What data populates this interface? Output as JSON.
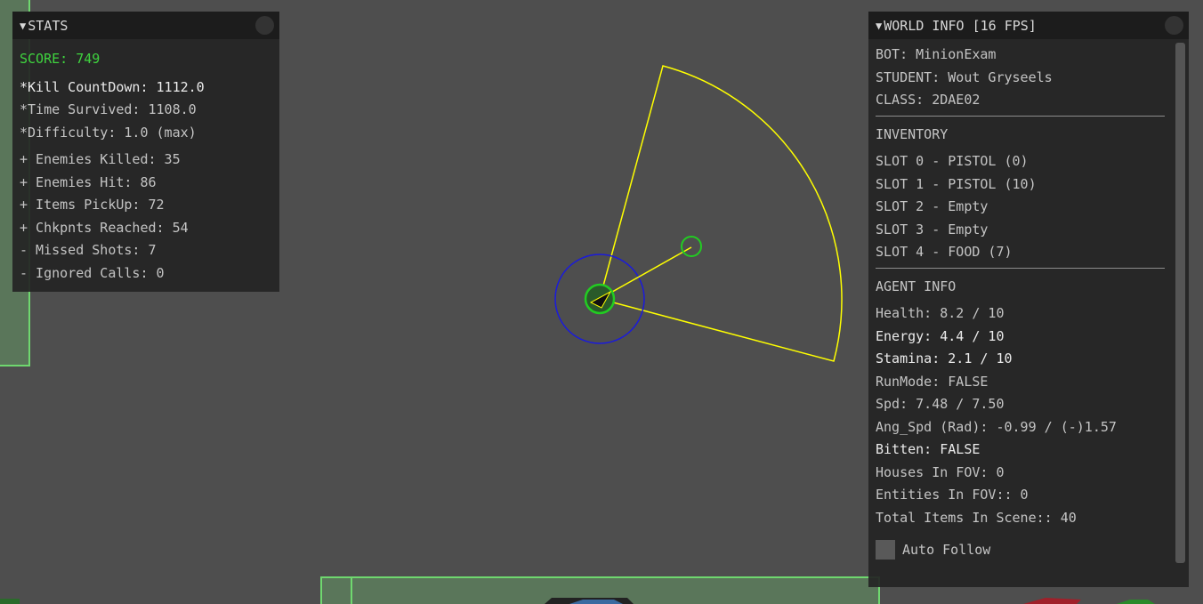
{
  "stats": {
    "title": "STATS",
    "score": "SCORE: 749",
    "lines": [
      "*Kill CountDown: 1112.0",
      "*Time Survived: 1108.0",
      "*Difficulty: 1.0 (max)",
      "+ Enemies Killed: 35",
      "+ Enemies Hit: 86",
      "+ Items PickUp: 72",
      "+ Chkpnts Reached: 54",
      "- Missed Shots: 7",
      "- Ignored Calls: 0"
    ]
  },
  "world": {
    "title": "WORLD INFO [16 FPS]",
    "bot": "BOT: MinionExam",
    "student": "STUDENT: Wout Gryseels",
    "class": "CLASS: 2DAE02",
    "inventory_header": "INVENTORY",
    "slots": [
      "SLOT 0 - PISTOL (0)",
      "SLOT 1 - PISTOL (10)",
      "SLOT 2 - Empty",
      "SLOT 3 - Empty",
      "SLOT 4 - FOOD (7)"
    ],
    "agent_header": "AGENT INFO",
    "agent": {
      "health": "Health: 8.2 / 10",
      "energy": "Energy: 4.4 / 10",
      "stamina": "Stamina: 2.1 / 10",
      "runmode": "RunMode: FALSE",
      "speed": "Spd: 7.48 / 7.50",
      "angular_speed": "Ang_Spd (Rad): -0.99 / (-)1.57",
      "bitten": "Bitten: FALSE",
      "houses_fov": "Houses In FOV: 0",
      "entities_fov": "Entities In FOV:: 0",
      "total_items": "Total Items In Scene:: 40"
    },
    "auto_follow_label": "Auto Follow"
  },
  "colors": {
    "background": "#4e4e4e",
    "fov_cone": "#ffff00",
    "agent_green": "#22cc22",
    "agent_radius_blue": "#1a1adc",
    "house_outline": "#6fd86f",
    "score_green": "#3fd43f"
  }
}
